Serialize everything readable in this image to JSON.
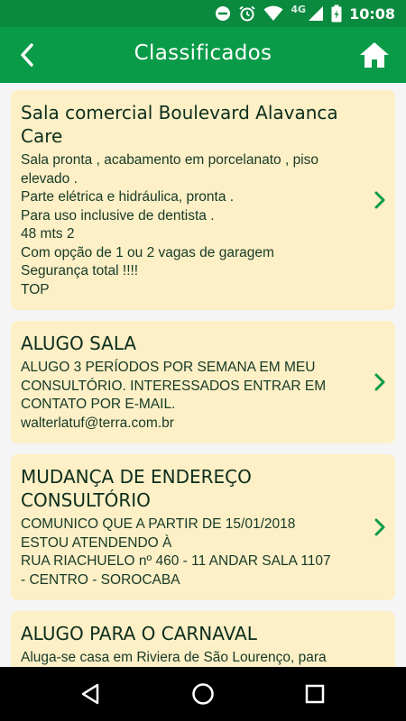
{
  "status_bar": {
    "network": "4G",
    "time": "10:08"
  },
  "app_bar": {
    "title": "Classificados"
  },
  "colors": {
    "status_bar": "#0a8a3f",
    "app_bar": "#0a9b48",
    "card": "#fdefc6",
    "chevron": "#0a9b48"
  },
  "items": [
    {
      "title_lines": [
        "Sala comercial Boulevard Alavanca",
        "Care"
      ],
      "body_lines": [
        "Sala pronta , acabamento em porcelanato , piso",
        "elevado .",
        "Parte elétrica e hidráulica, pronta .",
        "Para uso inclusive de dentista .",
        "48 mts 2",
        "Com opção de 1 ou 2 vagas de garagem",
        "Segurança total !!!!",
        "TOP"
      ]
    },
    {
      "title_lines": [
        "ALUGO SALA"
      ],
      "body_lines": [
        "ALUGO 3 PERÍODOS POR SEMANA EM MEU",
        "CONSULTÓRIO. INTERESSADOS ENTRAR EM",
        "CONTATO POR E-MAIL.",
        "walterlatuf@terra.com.br"
      ]
    },
    {
      "title_lines": [
        "MUDANÇA DE ENDEREÇO",
        "CONSULTÓRIO"
      ],
      "body_lines": [
        "COMUNICO QUE A PARTIR DE 15/01/2018",
        "ESTOU ATENDENDO À",
        "RUA RIACHUELO nº 460 - 11 ANDAR SALA 1107",
        "- CENTRO - SOROCABA"
      ]
    },
    {
      "title_lines": [
        "ALUGO PARA O CARNAVAL"
      ],
      "body_lines": [
        "Aluga-se casa em Riviera de São Lourenço, para"
      ]
    }
  ]
}
